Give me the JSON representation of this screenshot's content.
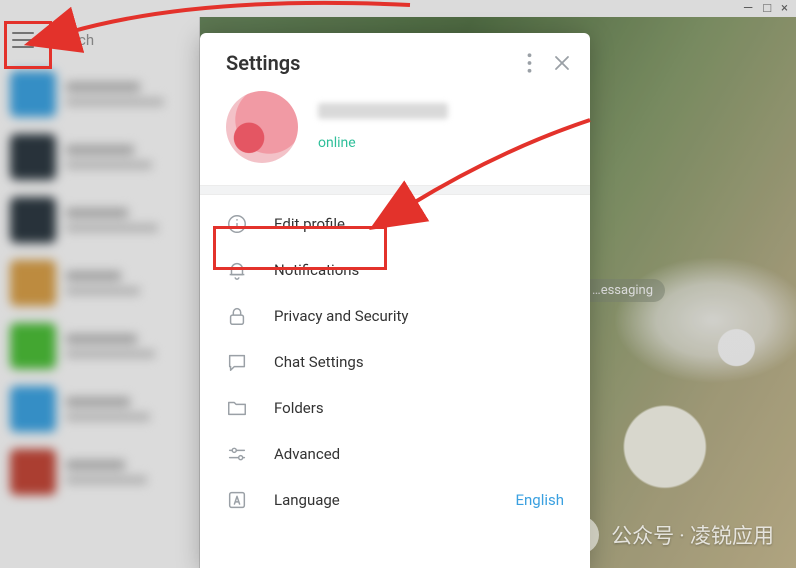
{
  "window": {
    "minimize": "—",
    "maximize": "□",
    "close": "×"
  },
  "search": {
    "placeholder": "Search"
  },
  "bg_chip": "…essaging",
  "settings": {
    "title": "Settings",
    "status": "online",
    "items": [
      {
        "key": "edit-profile",
        "label": "Edit profile"
      },
      {
        "key": "notifications",
        "label": "Notifications"
      },
      {
        "key": "privacy",
        "label": "Privacy and Security"
      },
      {
        "key": "chat-settings",
        "label": "Chat Settings"
      },
      {
        "key": "folders",
        "label": "Folders"
      },
      {
        "key": "advanced",
        "label": "Advanced"
      },
      {
        "key": "language",
        "label": "Language",
        "value": "English"
      }
    ]
  },
  "watermark": "公众号 · 凌锐应用",
  "chat_colors": [
    "#3ea6e6",
    "#2f3b44",
    "#2f3b44",
    "#dca24a",
    "#4ec23a",
    "#3ea6e6",
    "#c7493a"
  ]
}
